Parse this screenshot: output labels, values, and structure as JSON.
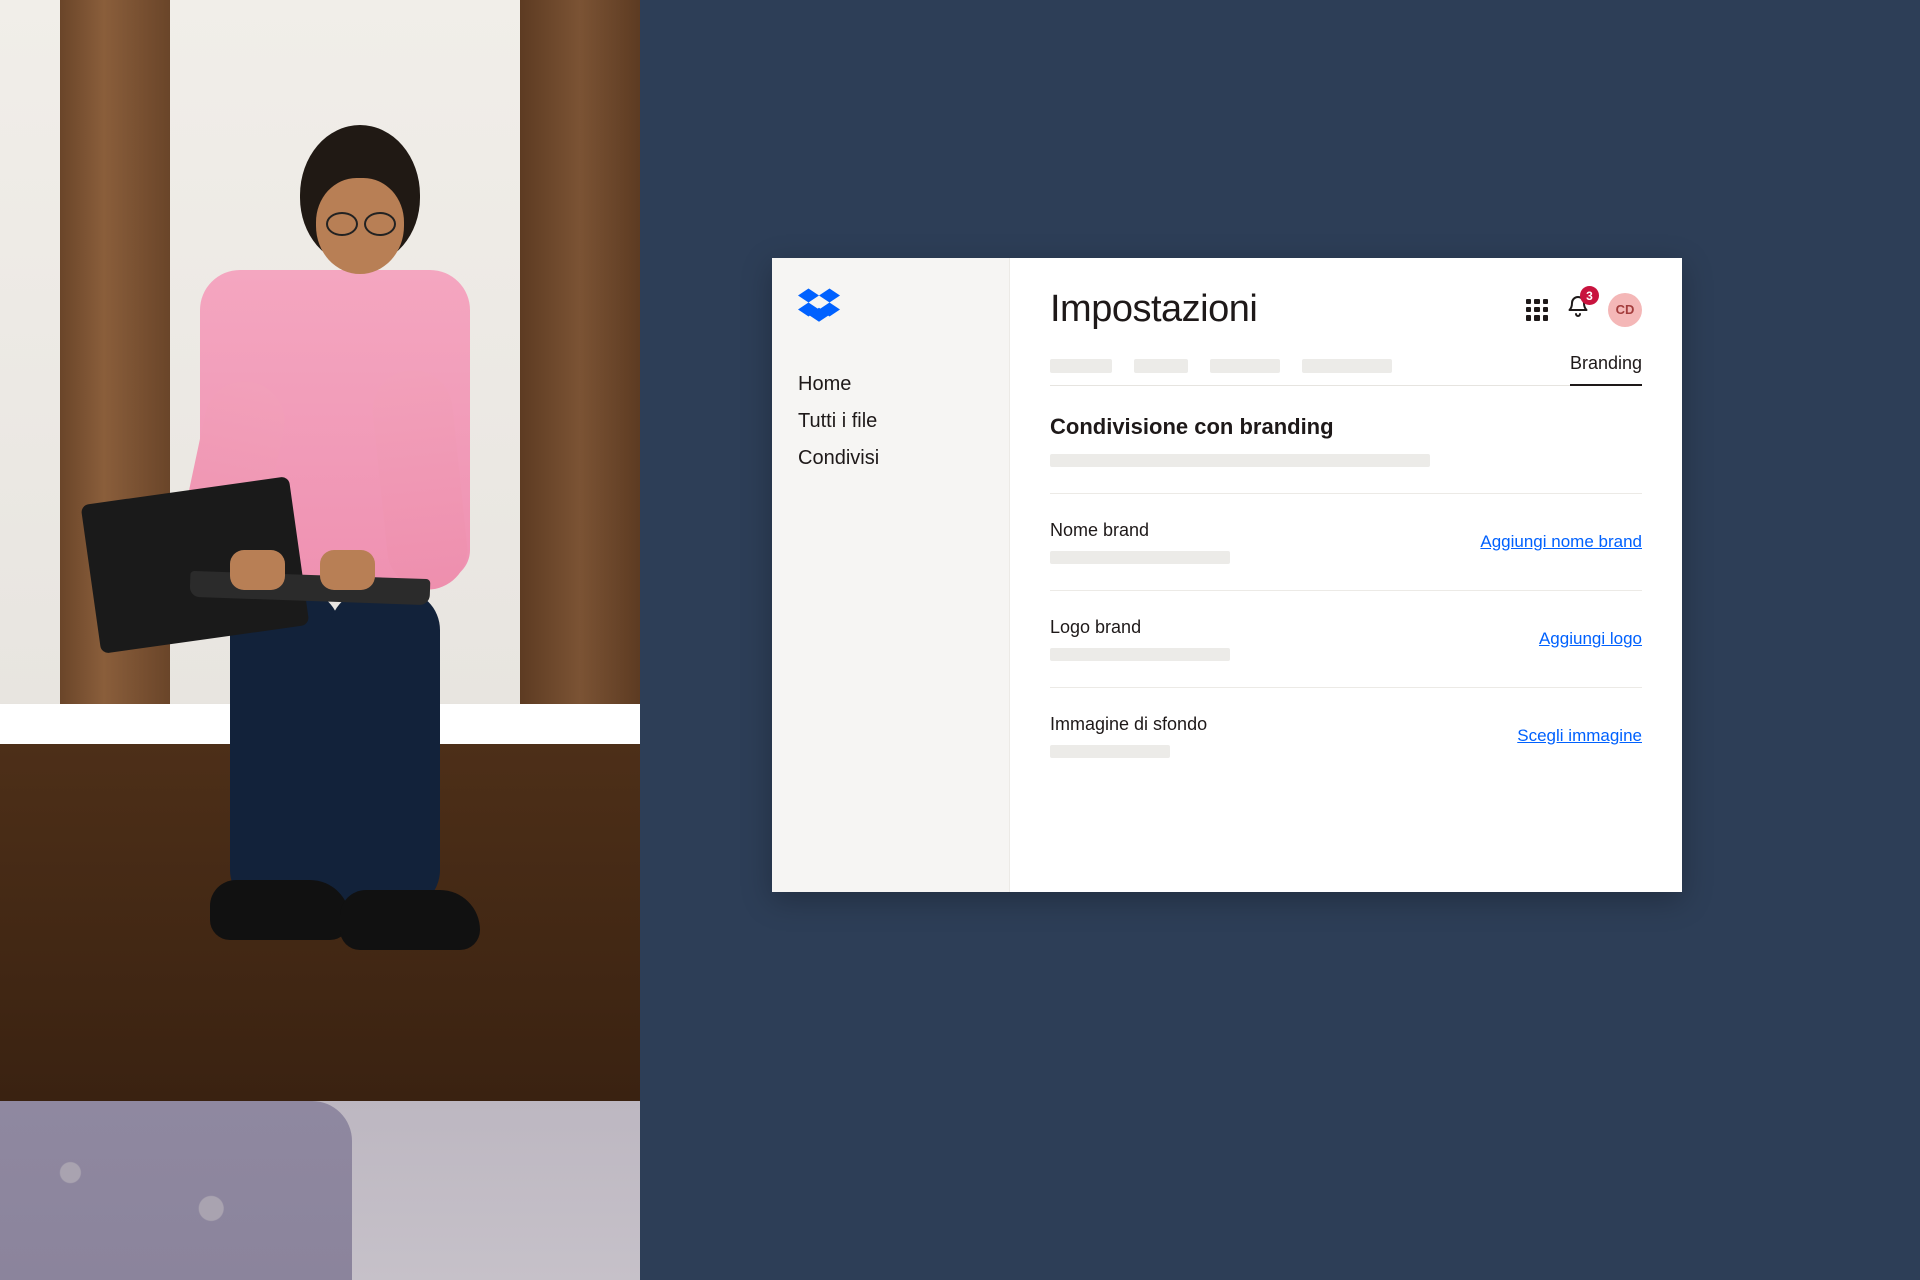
{
  "sidebar": {
    "items": [
      {
        "label": "Home"
      },
      {
        "label": "Tutti i file"
      },
      {
        "label": "Condivisi"
      }
    ]
  },
  "header": {
    "title": "Impostazioni",
    "notification_count": "3",
    "avatar_initials": "CD"
  },
  "tabs": {
    "active_label": "Branding"
  },
  "branding": {
    "section_title": "Condivisione con branding",
    "rows": [
      {
        "label": "Nome brand",
        "action": "Aggiungi nome brand"
      },
      {
        "label": "Logo brand",
        "action": "Aggiungi logo"
      },
      {
        "label": "Immagine di sfondo",
        "action": "Scegli immagine"
      }
    ]
  },
  "colors": {
    "accent": "#0061fe",
    "background_panel": "#2d3e57"
  }
}
